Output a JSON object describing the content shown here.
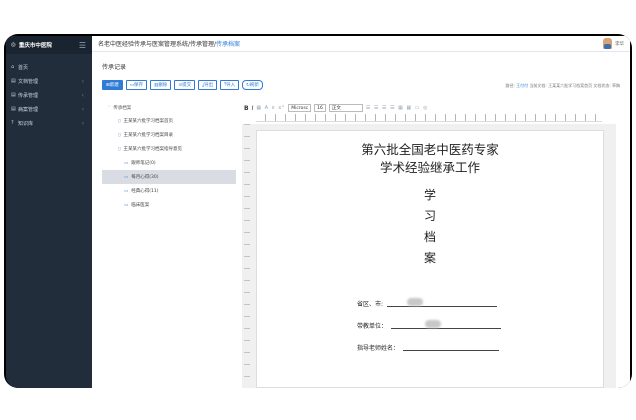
{
  "sidebar": {
    "brand": "重庆市中医院",
    "items": [
      {
        "label": "首页",
        "icon": "home-icon"
      },
      {
        "label": "文档管理",
        "icon": "document-icon"
      },
      {
        "label": "传承管理",
        "icon": "document-icon"
      },
      {
        "label": "病案管理",
        "icon": "document-icon"
      },
      {
        "label": "知识库",
        "icon": "question-icon"
      }
    ]
  },
  "header": {
    "breadcrumb_prefix": "名老中医经验传承与医案管理系统/传承管理/",
    "breadcrumb_current": "传承档案",
    "user_name": "李华"
  },
  "panel": {
    "title": "传承记录",
    "buttons": {
      "new": "新建",
      "save": "保存",
      "delete": "删除",
      "submit": "提交",
      "export": "导出",
      "import": "导入",
      "refresh": "刷新"
    },
    "status": {
      "label_position": "路径:",
      "position_link": "王付付",
      "label_doc": "当前文档:",
      "doc_name": "王某某六批学习档案首页",
      "label_state": "文档状态:",
      "state": "草稿"
    }
  },
  "tree": {
    "root": "传承档案",
    "items": [
      "王某某六批学习档案首页",
      "王某某六批学习档案目录",
      "王某某六批学习档案指导意见"
    ],
    "children": [
      {
        "label": "跟师笔记(0)",
        "selected": false
      },
      {
        "label": "每月心得(30)",
        "selected": true
      },
      {
        "label": "经典心得(11)",
        "selected": false
      },
      {
        "label": "临床医案",
        "selected": false
      }
    ]
  },
  "editor": {
    "font_name": "Microsc",
    "font_size": "16",
    "paragraph": "正文"
  },
  "document": {
    "title_line1": "第六批全国老中医药专家",
    "title_line2": "学术经验继承工作",
    "vertical_chars": [
      "学",
      "习",
      "档",
      "案"
    ],
    "field_province": "省区、市:",
    "field_unit": "带教单位：",
    "field_teacher": "指导老师姓名："
  },
  "colors": {
    "sidebar_bg": "#222d3c",
    "accent": "#2f7bd6"
  }
}
